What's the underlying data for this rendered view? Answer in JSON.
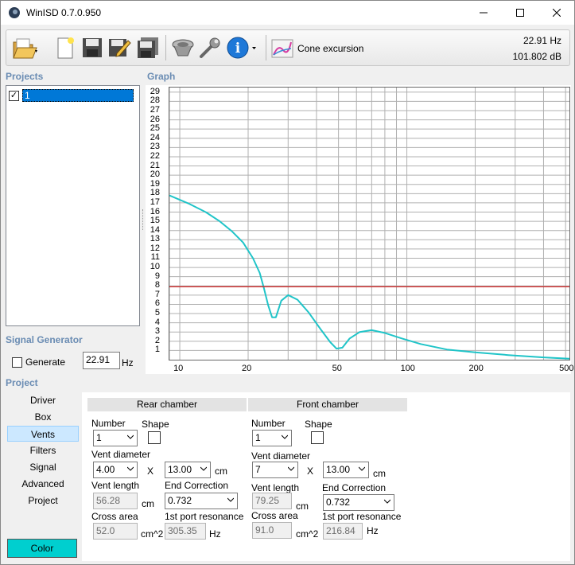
{
  "window": {
    "title": "WinISD 0.7.0.950",
    "minimize_icon": "minimize-icon",
    "maximize_icon": "maximize-icon",
    "close_icon": "close-icon"
  },
  "toolbar": {
    "graph_label": "Cone excursion",
    "readout_freq": "22.91 Hz",
    "readout_level": "101.802 dB",
    "icons": [
      "open-folder-icon",
      "new-project-icon",
      "save-icon",
      "save-as-icon",
      "save-all-icon",
      "driver-editor-icon",
      "settings-wrench-icon",
      "info-icon",
      "chart-icon"
    ]
  },
  "projects": {
    "label": "Projects",
    "items": [
      {
        "name": "1",
        "checked": true
      }
    ]
  },
  "graph": {
    "label": "Graph",
    "y_ticks": [
      "29",
      "28",
      "27",
      "26",
      "25",
      "24",
      "23",
      "22",
      "21",
      "20",
      "19",
      "18",
      "17",
      "16",
      "15",
      "14",
      "13",
      "12",
      "11",
      "10",
      "9",
      "8",
      "7",
      "6",
      "5",
      "4",
      "3",
      "2",
      "1"
    ],
    "x_ticks": [
      "10",
      "20",
      "50",
      "100",
      "200",
      "500"
    ]
  },
  "chart_data": {
    "type": "line",
    "x_scale": "log",
    "xlim": [
      9,
      520
    ],
    "ylim": [
      0,
      29.5
    ],
    "grid": true,
    "series": [
      {
        "color": "#20c4c8",
        "x": [
          9,
          11,
          13,
          15,
          17,
          19,
          21,
          22.5,
          23.5,
          24.5,
          25.5,
          26.5,
          28,
          30,
          33,
          37,
          42,
          46,
          49,
          52,
          56,
          62,
          70,
          80,
          95,
          115,
          150,
          200,
          280,
          400,
          520
        ],
        "y": [
          17.8,
          16.9,
          16.0,
          15.0,
          13.9,
          12.7,
          11.0,
          9.4,
          7.7,
          5.9,
          4.6,
          4.6,
          6.4,
          7.0,
          6.5,
          5.1,
          3.2,
          1.9,
          1.2,
          1.3,
          2.3,
          3.0,
          3.2,
          2.9,
          2.3,
          1.7,
          1.1,
          0.8,
          0.5,
          0.25,
          0.1
        ]
      },
      {
        "color": "#d02020",
        "x": [
          9,
          520
        ],
        "y": [
          7.9,
          7.9
        ]
      }
    ]
  },
  "signal_generator": {
    "label": "Signal Generator",
    "generate_label": "Generate",
    "generate_checked": false,
    "frequency": "22.91",
    "unit": "Hz"
  },
  "project": {
    "label": "Project",
    "nav": [
      "Driver",
      "Box",
      "Vents",
      "Filters",
      "Signal",
      "Advanced",
      "Project"
    ],
    "active_nav": "Vents",
    "color_button": "Color"
  },
  "rear": {
    "header": "Rear chamber",
    "number_label": "Number",
    "number": "1",
    "shape_label": "Shape",
    "vent_diameter_label": "Vent diameter",
    "diameter": "4.00",
    "x_label": "X",
    "diameter2": "13.00",
    "unit_cm": "cm",
    "vent_length_label": "Vent length",
    "vent_length": "56.28",
    "end_correction_label": "End Correction",
    "end_correction": "0.732",
    "cross_area_label": "Cross area",
    "cross_area": "52.0",
    "unit_cm2": "cm^2",
    "port_resonance_label": "1st port resonance",
    "port_resonance": "305.35",
    "unit_hz": "Hz"
  },
  "front": {
    "header": "Front chamber",
    "number_label": "Number",
    "number": "1",
    "shape_label": "Shape",
    "vent_diameter_label": "Vent diameter",
    "diameter": "7",
    "x_label": "X",
    "diameter2": "13.00",
    "unit_cm": "cm",
    "vent_length_label": "Vent length",
    "vent_length": "79.25",
    "end_correction_label": "End Correction",
    "end_correction": "0.732",
    "cross_area_label": "Cross area",
    "cross_area": "91.0",
    "unit_cm2": "cm^2",
    "port_resonance_label": "1st port resonance",
    "port_resonance": "216.84",
    "unit_hz": "Hz"
  }
}
